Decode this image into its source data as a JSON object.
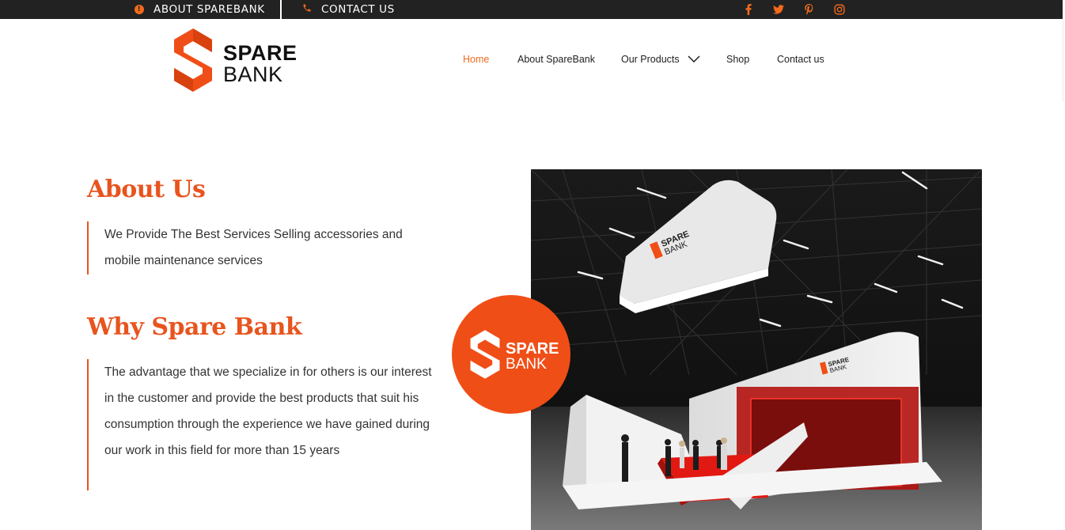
{
  "topbar": {
    "about_label": "ABOUT SPAREBANK",
    "contact_label": "CONTACT US",
    "social_icons": [
      "facebook-icon",
      "twitter-icon",
      "pinterest-icon",
      "instagram-icon"
    ]
  },
  "brand": {
    "line1": "SPARE",
    "line2": "BANK",
    "accent_color": "#f26a1b",
    "dark_color": "#222222"
  },
  "nav": {
    "items": [
      {
        "label": "Home",
        "active": true
      },
      {
        "label": "About SpareBank"
      },
      {
        "label": "Our Products"
      },
      {
        "label": "Shop"
      },
      {
        "label": "Contact us"
      }
    ]
  },
  "about": {
    "heading": "About Us",
    "text": "We Provide The Best Services Selling accessories and mobile maintenance services"
  },
  "why": {
    "heading": "Why Spare Bank",
    "text": "The advantage that we specialize in for others is our interest in the customer and provide the best products that suit his consumption through the experience we have gained during our work in this field for more than 15 years"
  },
  "photo": {
    "sign_top": "SPARE",
    "sign_bottom": "BANK"
  },
  "badge": {
    "line1": "SPARE",
    "line2": "BANK"
  }
}
